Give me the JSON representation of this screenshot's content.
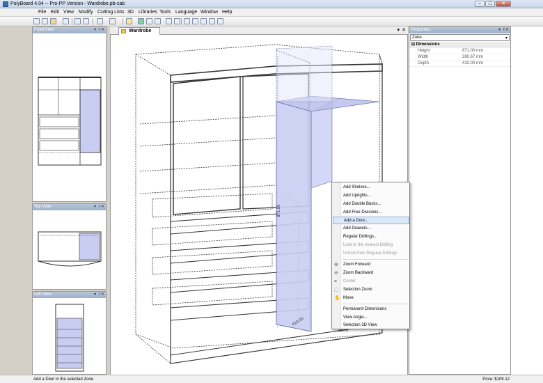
{
  "window": {
    "title": "PolyBoard 4.04 -- Pro-PP Version - Wardrobe.pb-cab",
    "minimize": "–",
    "maximize": "□",
    "close": "✕"
  },
  "menu": [
    "File",
    "Edit",
    "View",
    "Modify",
    "Cutting Lists",
    "3D",
    "Libraries",
    "Tools",
    "Language",
    "Window",
    "Help"
  ],
  "panes": {
    "front": "Front View",
    "top": "Top View",
    "left": "Left View"
  },
  "document_tab": "Wardrobe",
  "properties": {
    "title": "Properties",
    "selected": "Zone",
    "category": "Dimensions",
    "rows": [
      {
        "key": "Height",
        "value": "871.00 mm"
      },
      {
        "key": "Width",
        "value": "280.67 mm"
      },
      {
        "key": "Depth",
        "value": "410.00 mm"
      }
    ]
  },
  "dimension_labels": {
    "height": "871.00",
    "depth": "410.00",
    "width": "280.6"
  },
  "context_menu": [
    {
      "label": "Add Shelves...",
      "state": "normal",
      "icon": ""
    },
    {
      "label": "Add Uprights...",
      "state": "normal",
      "icon": ""
    },
    {
      "label": "Add Double Backs...",
      "state": "normal",
      "icon": ""
    },
    {
      "label": "Add Free Divisions...",
      "state": "normal",
      "icon": ""
    },
    {
      "label": "Add a Door...",
      "state": "highlight",
      "icon": ""
    },
    {
      "label": "Add Drawers...",
      "state": "normal",
      "icon": ""
    },
    {
      "label": "Regular Drillings...",
      "state": "normal",
      "icon": ""
    },
    {
      "label": "Lock to the nearest Drilling",
      "state": "disabled",
      "icon": ""
    },
    {
      "label": "Unlock from Regular Drillings",
      "state": "disabled",
      "icon": ""
    },
    {
      "label": "Zoom Forward",
      "state": "normal",
      "icon": "zoom-in-icon"
    },
    {
      "label": "Zoom Backward",
      "state": "normal",
      "icon": "zoom-out-icon"
    },
    {
      "label": "Center",
      "state": "disabled",
      "icon": "center-icon"
    },
    {
      "label": "Selection Zoom",
      "state": "normal",
      "icon": "selection-zoom-icon"
    },
    {
      "label": "Move",
      "state": "normal",
      "icon": "hand-icon"
    },
    {
      "label": "Permanent Dimensions",
      "state": "normal",
      "icon": ""
    },
    {
      "label": "View Angle...",
      "state": "normal",
      "icon": ""
    },
    {
      "label": "Selection 3D View",
      "state": "normal",
      "icon": ""
    }
  ],
  "status": {
    "message": "Add a Door in the selected Zone",
    "price": "Price: $109.12"
  },
  "colors": {
    "selection": "#c9cdf2",
    "highlight": "#dbe8f7",
    "pane_header": "#a8b9d0"
  }
}
